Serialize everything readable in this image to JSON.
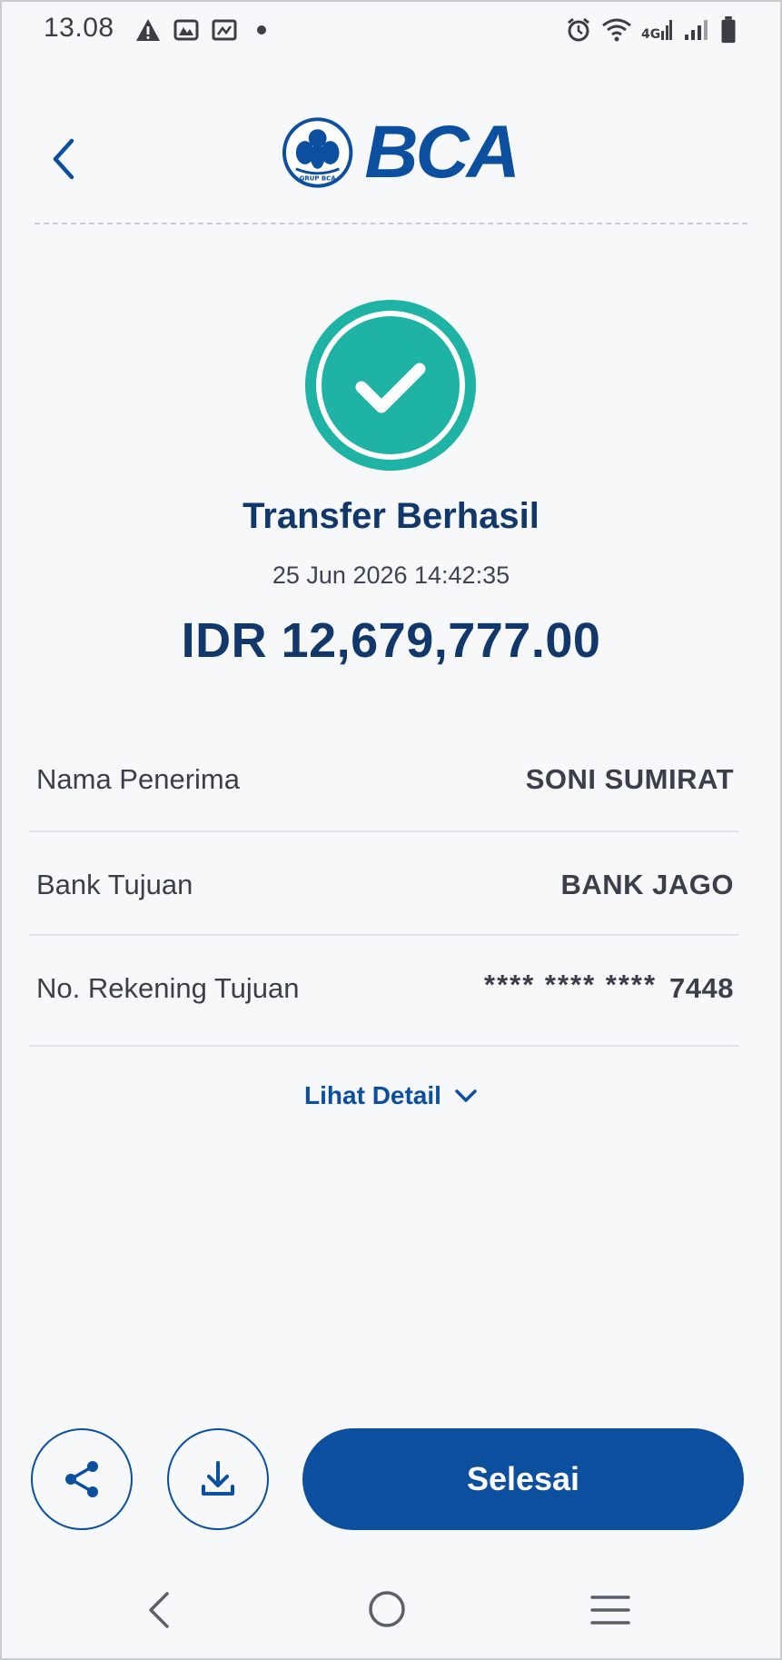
{
  "status_bar": {
    "time": "13.08",
    "left_icons": [
      "warning-icon",
      "gallery-icon",
      "screenshot-icon",
      "dot-icon"
    ],
    "right_icons": [
      "alarm-icon",
      "wifi-icon",
      "4g-signal-icon",
      "signal-icon",
      "battery-icon"
    ]
  },
  "header": {
    "back_icon": "chevron-left-icon",
    "logo_text": "BCA",
    "logo_subtext": "GRUP BCA"
  },
  "transaction": {
    "status_icon": "check-circle-icon",
    "title": "Transfer Berhasil",
    "datetime": "25 Jun 2026 14:42:35",
    "amount": "IDR 12,679,777.00"
  },
  "details": [
    {
      "label": "Nama Penerima",
      "value": "SONI SUMIRAT"
    },
    {
      "label": "Bank Tujuan",
      "value": "BANK JAGO"
    },
    {
      "label": "No. Rekening Tujuan",
      "mask": "**** **** ****",
      "value": "7448"
    }
  ],
  "see_detail": {
    "label": "Lihat Detail",
    "icon": "chevron-down-icon"
  },
  "actions": {
    "share_icon": "share-icon",
    "download_icon": "download-icon",
    "done_label": "Selesai"
  },
  "nav_bar": {
    "back_icon": "nav-back-icon",
    "home_icon": "nav-home-icon",
    "recents_icon": "nav-menu-icon"
  },
  "colors": {
    "primary": "#0b4f9e",
    "title": "#12386b",
    "success": "#1fb3a6"
  }
}
